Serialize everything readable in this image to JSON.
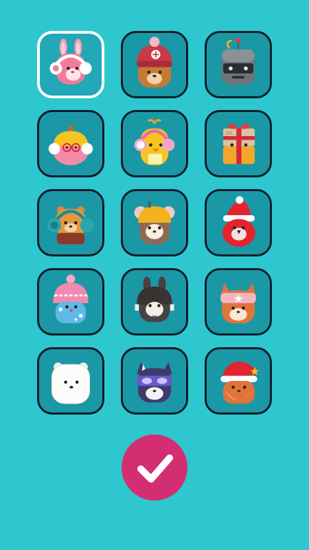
{
  "theme": {
    "background": "#2ec7cf",
    "tile_fill": "#1b98a6",
    "tile_border": "#0f1e2a",
    "selected_border": "#ffffff",
    "confirm_color": "#d42e73"
  },
  "characters": [
    {
      "name": "pink-bunny-headphones",
      "selected": true
    },
    {
      "name": "bear-red-beanie",
      "selected": false
    },
    {
      "name": "robot-gray-visor",
      "selected": false
    },
    {
      "name": "pink-blob-yellow-hat-glasses",
      "selected": false
    },
    {
      "name": "yellow-chick-headphones",
      "selected": false
    },
    {
      "name": "gift-box-ribbon",
      "selected": false
    },
    {
      "name": "bear-green-headphones",
      "selected": false
    },
    {
      "name": "mouse-yellow-helmet",
      "selected": false
    },
    {
      "name": "penguin-santa-hat",
      "selected": false
    },
    {
      "name": "bird-pink-knit-hat",
      "selected": false
    },
    {
      "name": "bunny-aviator-cap",
      "selected": false
    },
    {
      "name": "fox-star-headband",
      "selected": false
    },
    {
      "name": "polar-bear",
      "selected": false
    },
    {
      "name": "raccoon-goggles",
      "selected": false
    },
    {
      "name": "fox-santa-hat-beard",
      "selected": false
    }
  ],
  "confirm_button": {
    "icon": "checkmark-icon"
  }
}
